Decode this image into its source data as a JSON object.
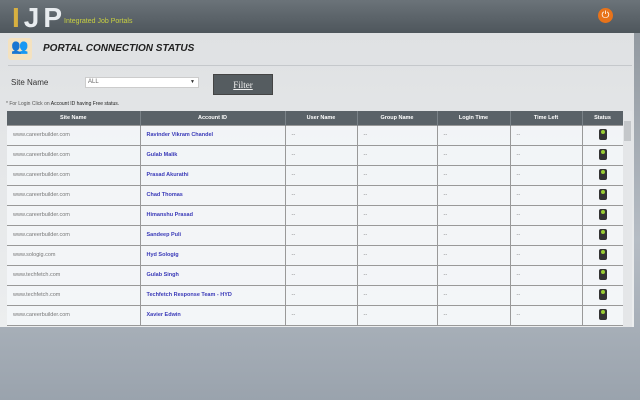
{
  "header": {
    "logo": "IJP",
    "tagline": "Integrated Job Portals"
  },
  "page": {
    "title": "PORTAL CONNECTION STATUS"
  },
  "filter": {
    "label": "Site Name",
    "selected": "ALL",
    "button": "Filter"
  },
  "note": {
    "prefix": "* For Login Click on",
    "text": "Account ID having Free status."
  },
  "table": {
    "headers": [
      "Site Name",
      "Account ID",
      "User Name",
      "Group Name",
      "Login Time",
      "Time Left",
      "Status"
    ],
    "rows": [
      {
        "site": "www.careerbuilder.com",
        "account": "Ravinder Vikram Chandel",
        "user": "--",
        "group": "--",
        "login": "--",
        "left": "--"
      },
      {
        "site": "www.careerbuilder.com",
        "account": "Gulab Malik",
        "user": "--",
        "group": "--",
        "login": "--",
        "left": "--"
      },
      {
        "site": "www.careerbuilder.com",
        "account": "Prasad Akurathi",
        "user": "--",
        "group": "--",
        "login": "--",
        "left": "--"
      },
      {
        "site": "www.careerbuilder.com",
        "account": "Chad Thomas",
        "user": "--",
        "group": "--",
        "login": "--",
        "left": "--"
      },
      {
        "site": "www.careerbuilder.com",
        "account": "Himanshu Prasad",
        "user": "--",
        "group": "--",
        "login": "--",
        "left": "--"
      },
      {
        "site": "www.careerbuilder.com",
        "account": "Sandeep Puli",
        "user": "--",
        "group": "--",
        "login": "--",
        "left": "--"
      },
      {
        "site": "www.sologig.com",
        "account": "Hyd Sologig",
        "user": "--",
        "group": "--",
        "login": "--",
        "left": "--"
      },
      {
        "site": "www.techfetch.com",
        "account": "Gulab Singh",
        "user": "--",
        "group": "--",
        "login": "--",
        "left": "--"
      },
      {
        "site": "www.techfetch.com",
        "account": "Techfetch Response Team - HYD",
        "user": "--",
        "group": "--",
        "login": "--",
        "left": "--"
      },
      {
        "site": "www.careerbuilder.com",
        "account": "Xavier Edwin",
        "user": "--",
        "group": "--",
        "login": "--",
        "left": "--"
      }
    ]
  }
}
